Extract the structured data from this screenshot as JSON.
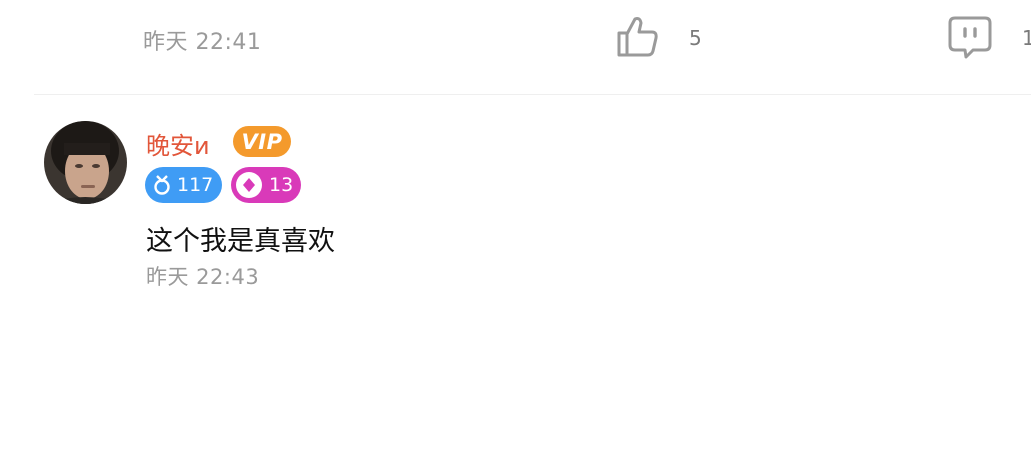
{
  "previous_comment": {
    "time": "昨天 22:41",
    "like_count": "5",
    "reply_count": "1",
    "like_icon": "thumbs-up-icon",
    "reply_icon": "comment-bubble-icon"
  },
  "comment": {
    "username": "晚安и",
    "vip_label": "VIP",
    "level_icon": "level-icon",
    "level": "117",
    "fan_icon": "fan-diamond-icon",
    "fan_level": "13",
    "text": "这个我是真喜欢",
    "time": "昨天 22:43"
  },
  "colors": {
    "username": "#e2563a",
    "vip": "#f49a2c",
    "level_badge": "#3f9cf5",
    "fan_badge": "#d93ab9",
    "meta_text": "#9a9a9a"
  }
}
